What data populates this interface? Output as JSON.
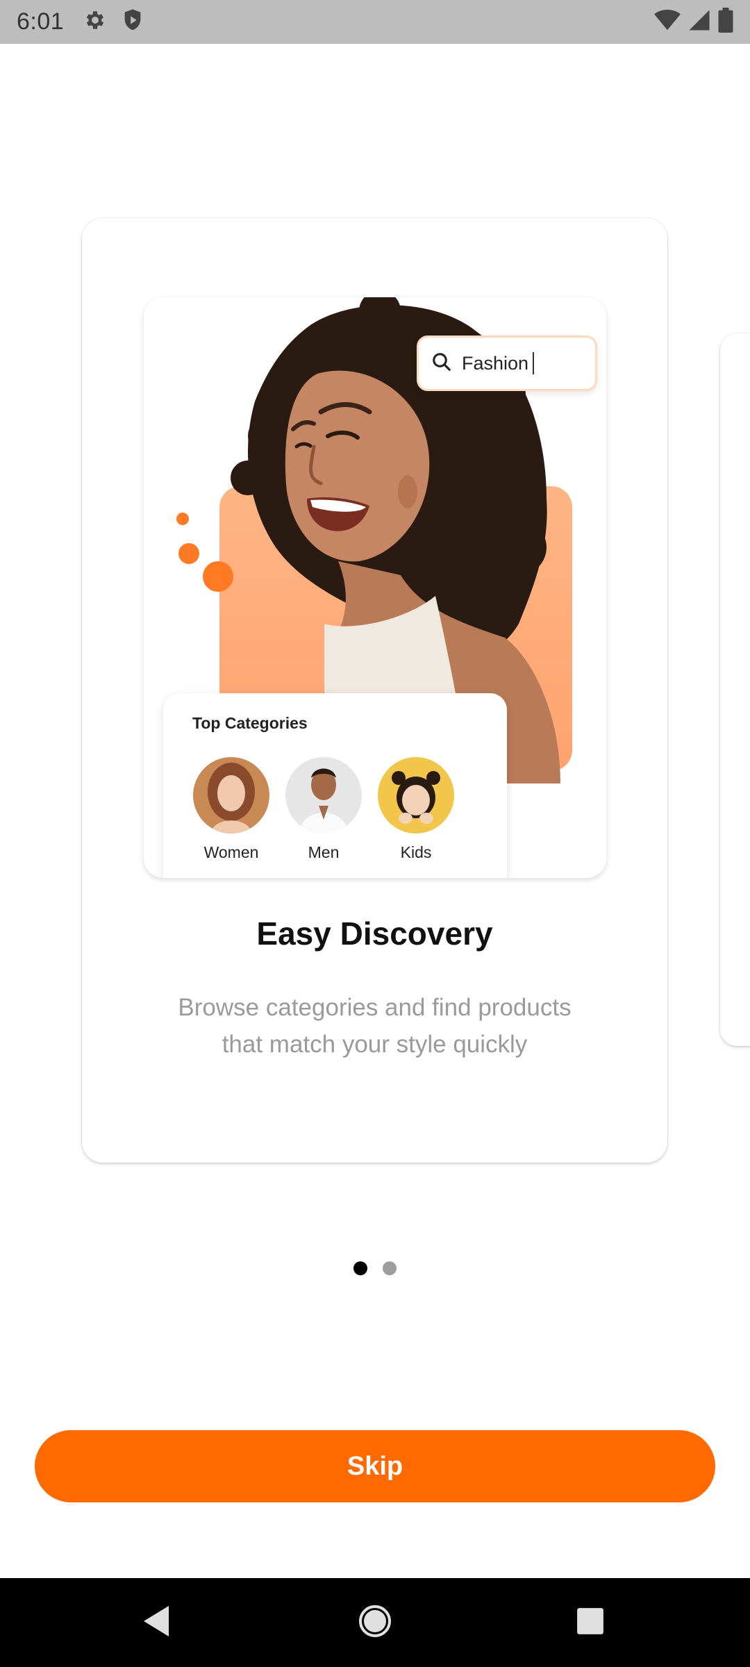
{
  "status_bar": {
    "time": "6:01",
    "left_icons": [
      "gear-icon",
      "shield-icon"
    ],
    "right_icons": [
      "wifi-icon",
      "signal-icon",
      "battery-icon"
    ]
  },
  "onboarding": {
    "illustration": {
      "search_text": "Fashion",
      "categories_title": "Top Categories",
      "categories": [
        {
          "label": "Women"
        },
        {
          "label": "Men"
        },
        {
          "label": "Kids"
        }
      ]
    },
    "title": "Easy Discovery",
    "description": "Browse categories and find products that match your style quickly"
  },
  "pagination": {
    "count": 2,
    "active_index": 0
  },
  "skip_label": "Skip",
  "nav_bar": {
    "buttons": [
      "back-icon",
      "home-icon",
      "recents-icon"
    ]
  },
  "colors": {
    "accent": "#ff6a00",
    "status_bar_bg": "#bdbdbd",
    "nav_bar_bg": "#000000",
    "description_text": "#9a9a9a"
  }
}
